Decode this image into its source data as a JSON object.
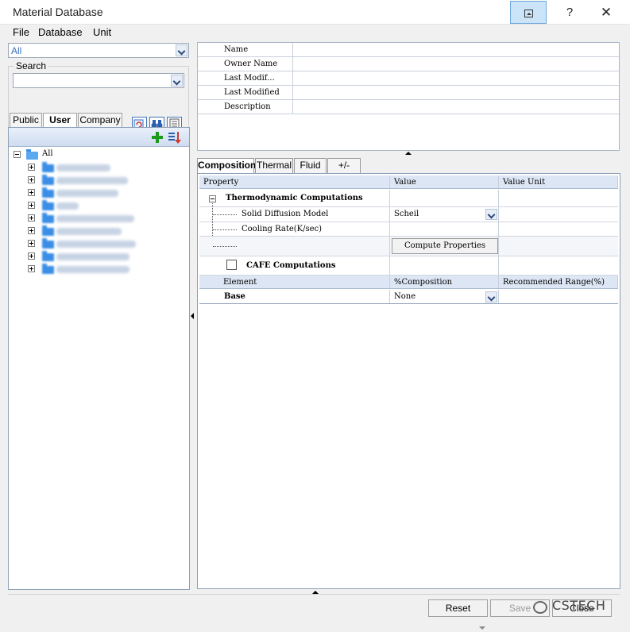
{
  "window": {
    "title": "Material Database",
    "help_label": "?",
    "close_label": "✕"
  },
  "menu": [
    {
      "label": "File"
    },
    {
      "label": "Database"
    },
    {
      "label": "Unit"
    }
  ],
  "filter": {
    "selected": "All"
  },
  "search": {
    "label": "Search",
    "value": ""
  },
  "scope_tabs": [
    {
      "label": "Public"
    },
    {
      "label": "User"
    },
    {
      "label": "Company"
    }
  ],
  "tree": {
    "root_label": "All",
    "child_count": 9
  },
  "info": {
    "rows": [
      {
        "label": "Name",
        "value": ""
      },
      {
        "label": "Owner Name",
        "value": ""
      },
      {
        "label": "Last Modif...",
        "value": ""
      },
      {
        "label": "Last Modified",
        "value": ""
      },
      {
        "label": "Description",
        "value": ""
      }
    ]
  },
  "tabs": [
    {
      "label": "Composition"
    },
    {
      "label": "Thermal"
    },
    {
      "label": "Fluid"
    },
    {
      "label": "+/-"
    }
  ],
  "property_grid": {
    "headers": {
      "property": "Property",
      "value": "Value",
      "unit": "Value Unit"
    },
    "thermo_section": "Thermodynamic Computations",
    "solid_diffusion_label": "Solid Diffusion Model",
    "solid_diffusion_value": "Scheil",
    "cooling_rate_label": "Cooling Rate(K/sec)",
    "compute_button": "Compute Properties",
    "cafe_label": "CAFE Computations"
  },
  "element_grid": {
    "headers": {
      "element": "Element",
      "composition": "%Composition",
      "range": "Recommended Range(%)"
    },
    "base_label": "Base",
    "base_value": "None"
  },
  "buttons": {
    "reset": "Reset",
    "save": "Save",
    "close": "Close"
  },
  "watermark": "CSTECH",
  "colors": {
    "accent": "#3a8ee6",
    "header_bg": "#dce6f4",
    "restore_highlight": "#cce4f7"
  }
}
